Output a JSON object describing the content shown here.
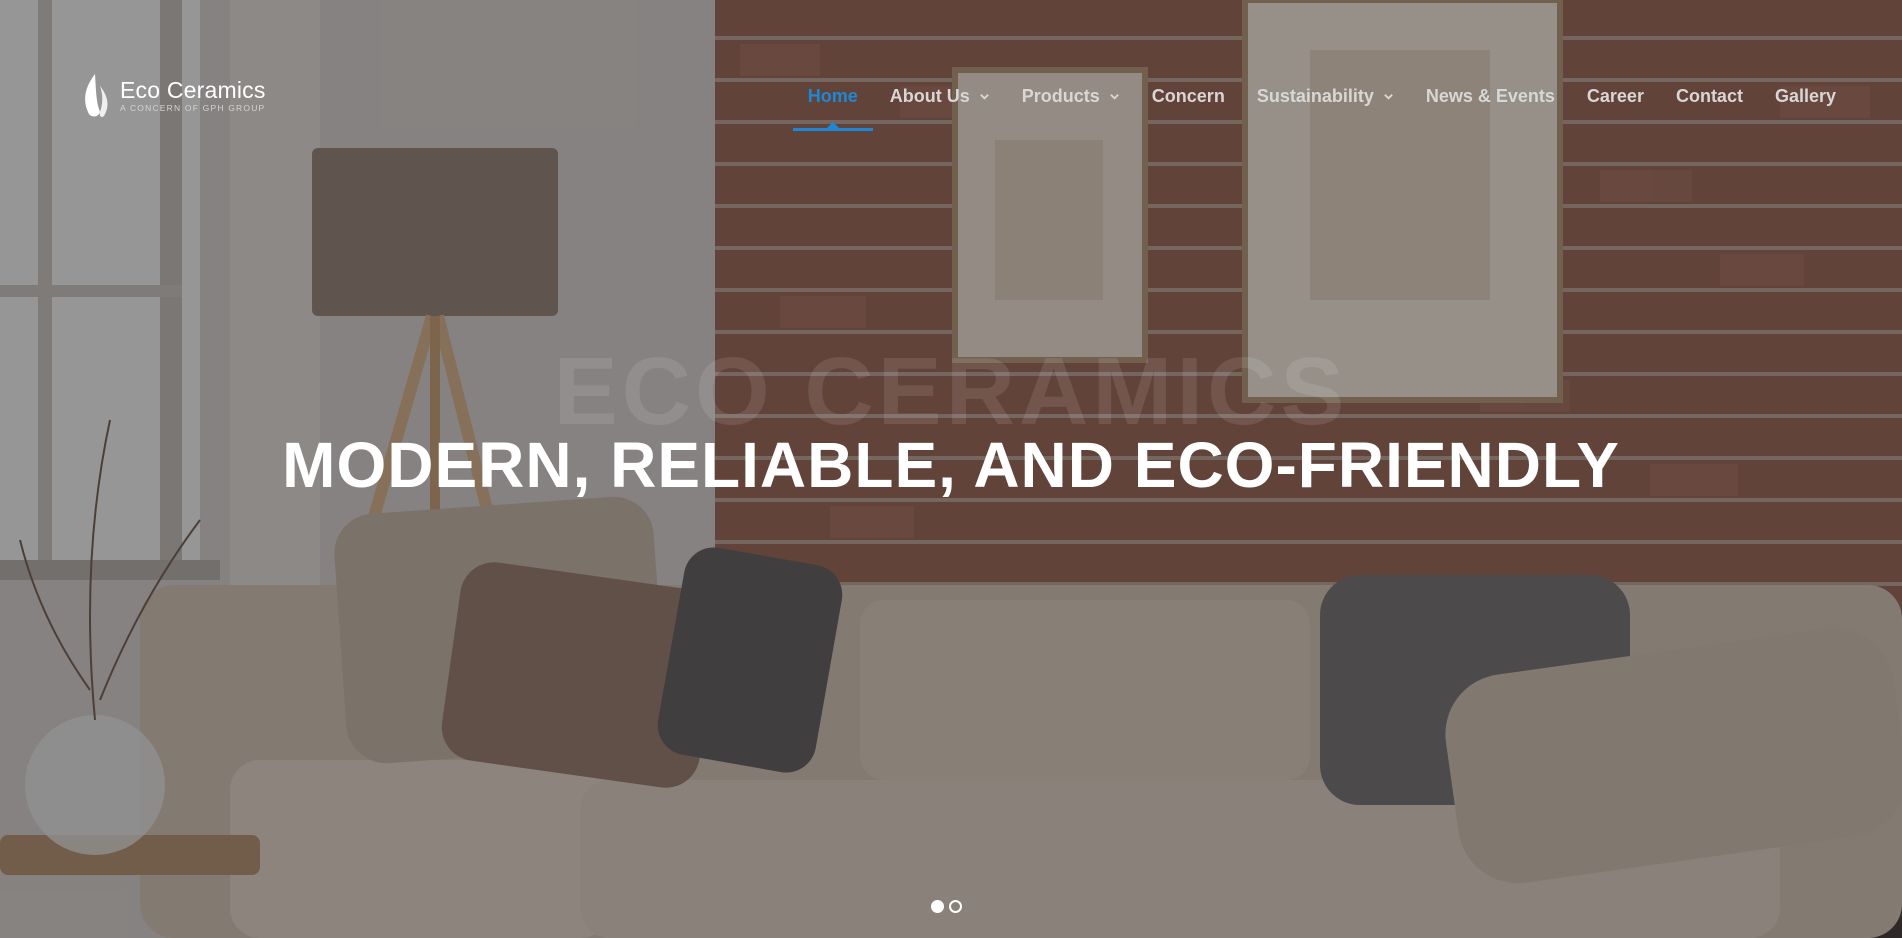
{
  "brand": {
    "name": "Eco Ceramics",
    "tagline": "A Concern of GPH Group",
    "logo_icon": "flame-leaf-icon"
  },
  "nav": {
    "active_color": "#1e88d6",
    "items": [
      {
        "label": "Home",
        "active": true,
        "has_dropdown": false
      },
      {
        "label": "About Us",
        "active": false,
        "has_dropdown": true
      },
      {
        "label": "Products",
        "active": false,
        "has_dropdown": true
      },
      {
        "label": "Concern",
        "active": false,
        "has_dropdown": false
      },
      {
        "label": "Sustainability",
        "active": false,
        "has_dropdown": true
      },
      {
        "label": "News & Events",
        "active": false,
        "has_dropdown": false
      },
      {
        "label": "Career",
        "active": false,
        "has_dropdown": false
      },
      {
        "label": "Contact",
        "active": false,
        "has_dropdown": false
      },
      {
        "label": "Gallery",
        "active": false,
        "has_dropdown": false
      }
    ]
  },
  "hero": {
    "watermark": "ECO CERAMICS",
    "headline": "MODERN, RELIABLE, AND ECO-FRIENDLY",
    "slides_total": 2,
    "active_slide": 1
  }
}
